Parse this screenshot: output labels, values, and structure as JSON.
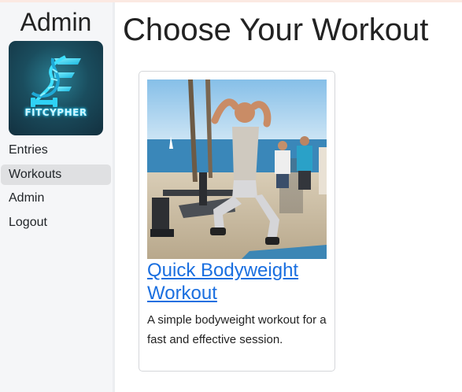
{
  "sidebar": {
    "title": "Admin",
    "logo_text": "FITCYPHER",
    "items": [
      {
        "label": "Entries",
        "active": false
      },
      {
        "label": "Workouts",
        "active": true
      },
      {
        "label": "Admin",
        "active": false
      },
      {
        "label": "Logout",
        "active": false
      }
    ]
  },
  "main": {
    "title": "Choose Your Workout",
    "cards": [
      {
        "title": "Quick Bodyweight Workout",
        "description": "A simple bodyweight workout for a fast and effective session."
      }
    ]
  },
  "colors": {
    "link": "#1a6fe0",
    "sidebar_bg": "#f5f6f8",
    "active_item_bg": "#dfe0e2"
  }
}
